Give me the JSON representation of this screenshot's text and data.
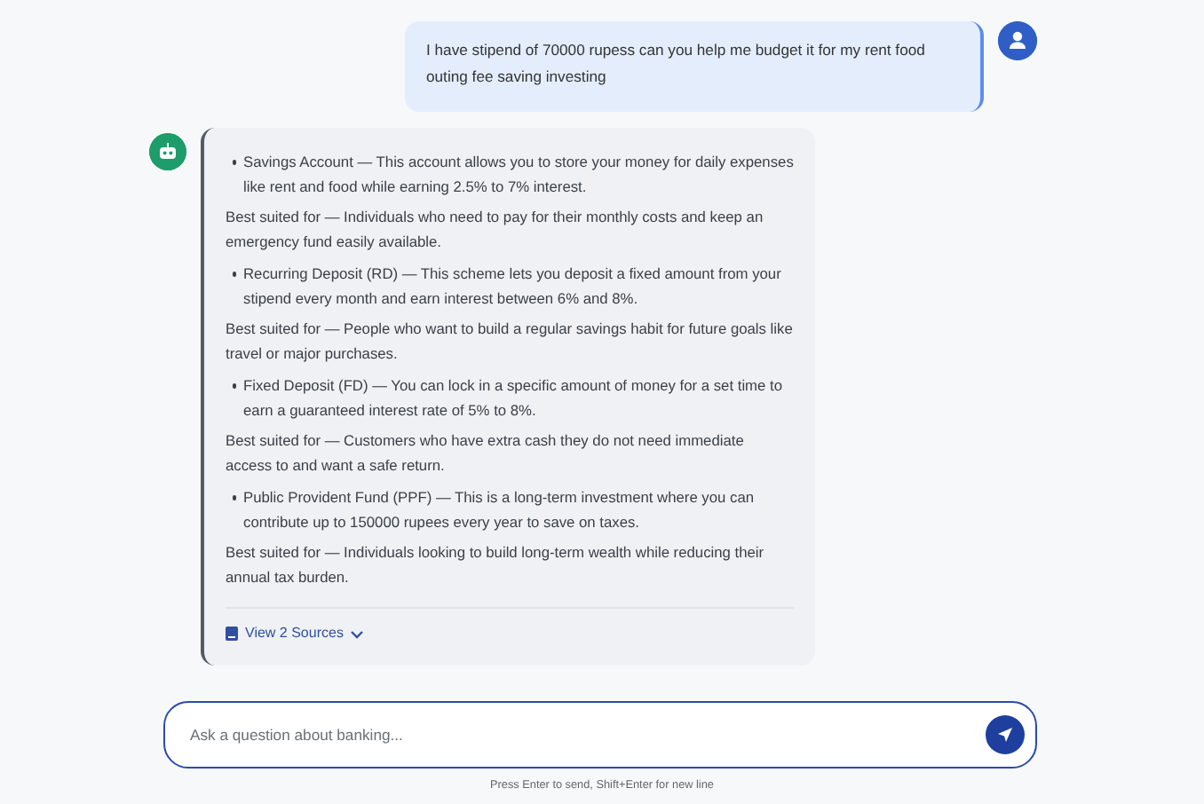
{
  "messages": [
    {
      "kind": "user",
      "text": "I have stipend of 70000 rupess can you help me budget it for my rent food outing fee saving investing"
    },
    {
      "kind": "bot",
      "blocks": [
        {
          "kind": "bullet",
          "text": "Savings Account — This account allows you to store your money for daily expenses like rent and food while earning 2.5% to 7% interest."
        },
        {
          "kind": "paragraph",
          "text": "Best suited for — Individuals who need to pay for their monthly costs and keep an emergency fund easily available."
        },
        {
          "kind": "bullet",
          "text": "Recurring Deposit (RD) — This scheme lets you deposit a fixed amount from your stipend every month and earn interest between 6% and 8%."
        },
        {
          "kind": "paragraph",
          "text": "Best suited for — People who want to build a regular savings habit for future goals like travel or major purchases."
        },
        {
          "kind": "bullet",
          "text": "Fixed Deposit (FD) — You can lock in a specific amount of money for a set time to earn a guaranteed interest rate of 5% to 8%."
        },
        {
          "kind": "paragraph",
          "text": "Best suited for — Customers who have extra cash they do not need immediate access to and want a safe return."
        },
        {
          "kind": "bullet",
          "text": "Public Provident Fund (PPF) — This is a long-term investment where you can contribute up to 150000 rupees every year to save on taxes."
        },
        {
          "kind": "paragraph",
          "text": "Best suited for — Individuals looking to build long-term wealth while reducing their annual tax burden."
        }
      ],
      "sources_label": "View 2 Sources",
      "sources_expanded": false
    }
  ],
  "input": {
    "placeholder": "Ask a question about banking..."
  },
  "hint": "Press Enter to send, Shift+Enter for new line"
}
